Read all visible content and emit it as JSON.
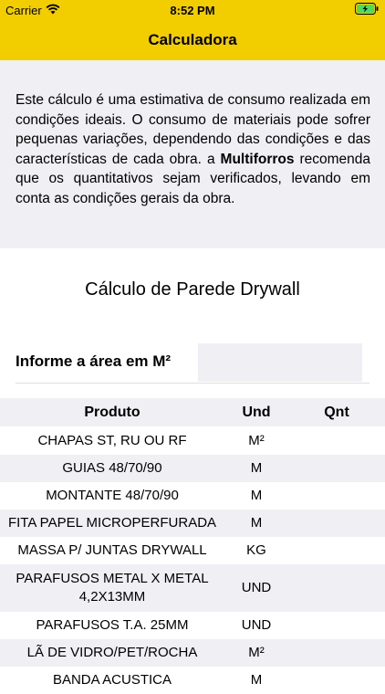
{
  "status_bar": {
    "carrier": "Carrier",
    "time": "8:52 PM",
    "icons": [
      "wifi-icon",
      "battery-charging-icon"
    ]
  },
  "nav": {
    "title": "Calculadora"
  },
  "info": {
    "text_before": "Este cálculo é uma estimativa de consumo realizada em condições ideais. O consumo de materiais pode sofrer pequenas variações, dependendo das condições e das características de cada obra. a ",
    "brand": "Multiforros",
    "text_after": " recomenda que os quantitativos sejam verificados, levando em conta as condições gerais da obra."
  },
  "calc": {
    "title": "Cálculo de Parede Drywall",
    "area_label": "Informe a área em M²",
    "area_value": ""
  },
  "table": {
    "headers": {
      "produto": "Produto",
      "und": "Und",
      "qnt": "Qnt"
    },
    "rows": [
      {
        "produto": "CHAPAS ST, RU OU RF",
        "und": "M²",
        "qnt": ""
      },
      {
        "produto": "GUIAS 48/70/90",
        "und": "M",
        "qnt": ""
      },
      {
        "produto": "MONTANTE 48/70/90",
        "und": "M",
        "qnt": ""
      },
      {
        "produto": "FITA PAPEL MICROPERFURADA",
        "und": "M",
        "qnt": ""
      },
      {
        "produto": "MASSA P/ JUNTAS DRYWALL",
        "und": "KG",
        "qnt": ""
      },
      {
        "produto": "PARAFUSOS METAL X METAL 4,2X13MM",
        "und": "UND",
        "qnt": ""
      },
      {
        "produto": "PARAFUSOS T.A. 25MM",
        "und": "UND",
        "qnt": ""
      },
      {
        "produto": "LÃ DE VIDRO/PET/ROCHA",
        "und": "M²",
        "qnt": ""
      },
      {
        "produto": "BANDA ACUSTICA",
        "und": "M",
        "qnt": ""
      }
    ]
  },
  "colors": {
    "accent": "#f2cd00",
    "panel": "#f0eff4"
  }
}
